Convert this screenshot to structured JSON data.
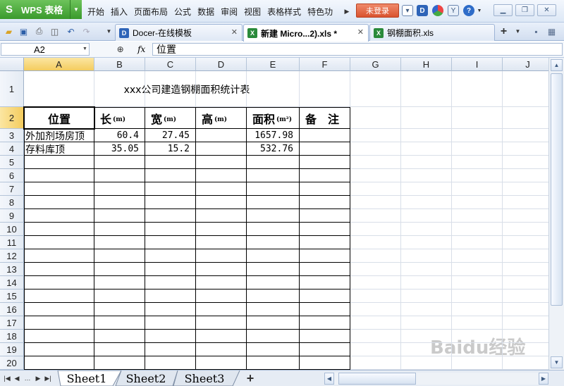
{
  "menubar": {
    "app_button": "WPS 表格",
    "items": [
      "开始",
      "插入",
      "页面布局",
      "公式",
      "数据",
      "审阅",
      "视图",
      "表格样式",
      "特色功"
    ],
    "login_label": "未登录"
  },
  "tabs": [
    {
      "label": "Docer-在线模板",
      "icon": "docer-icon"
    },
    {
      "label": "新建 Micro...2).xls *",
      "icon": "excel-icon",
      "active": true
    },
    {
      "label": "钢棚面积.xls",
      "icon": "excel-icon"
    }
  ],
  "formula_bar": {
    "cell_ref": "A2",
    "fx": "fx",
    "value": "位置"
  },
  "columns": [
    "A",
    "B",
    "C",
    "D",
    "E",
    "F",
    "G",
    "H",
    "I",
    "J"
  ],
  "rows": [
    "1",
    "2",
    "3",
    "4",
    "5",
    "6",
    "7",
    "8",
    "9",
    "10",
    "11",
    "12",
    "13",
    "14",
    "15",
    "16",
    "17",
    "18",
    "19",
    "20"
  ],
  "sheet": {
    "title": "xxx公司建造钢棚面积统计表",
    "headers": [
      {
        "label": "位置",
        "unit": ""
      },
      {
        "label": "长",
        "unit": "(m)"
      },
      {
        "label": "宽",
        "unit": "(m)"
      },
      {
        "label": "高",
        "unit": "(m)"
      },
      {
        "label": "面积",
        "unit": "(m²)"
      },
      {
        "label": "备　注",
        "unit": ""
      }
    ],
    "data": [
      [
        "外加剂场房顶",
        "60.4",
        "27.45",
        "",
        "1657.98",
        ""
      ],
      [
        "存料库顶",
        "35.05",
        "15.2",
        "",
        "532.76",
        ""
      ]
    ]
  },
  "sheet_tabs": [
    "Sheet1",
    "Sheet2",
    "Sheet3"
  ],
  "watermark": "Baidu经验"
}
